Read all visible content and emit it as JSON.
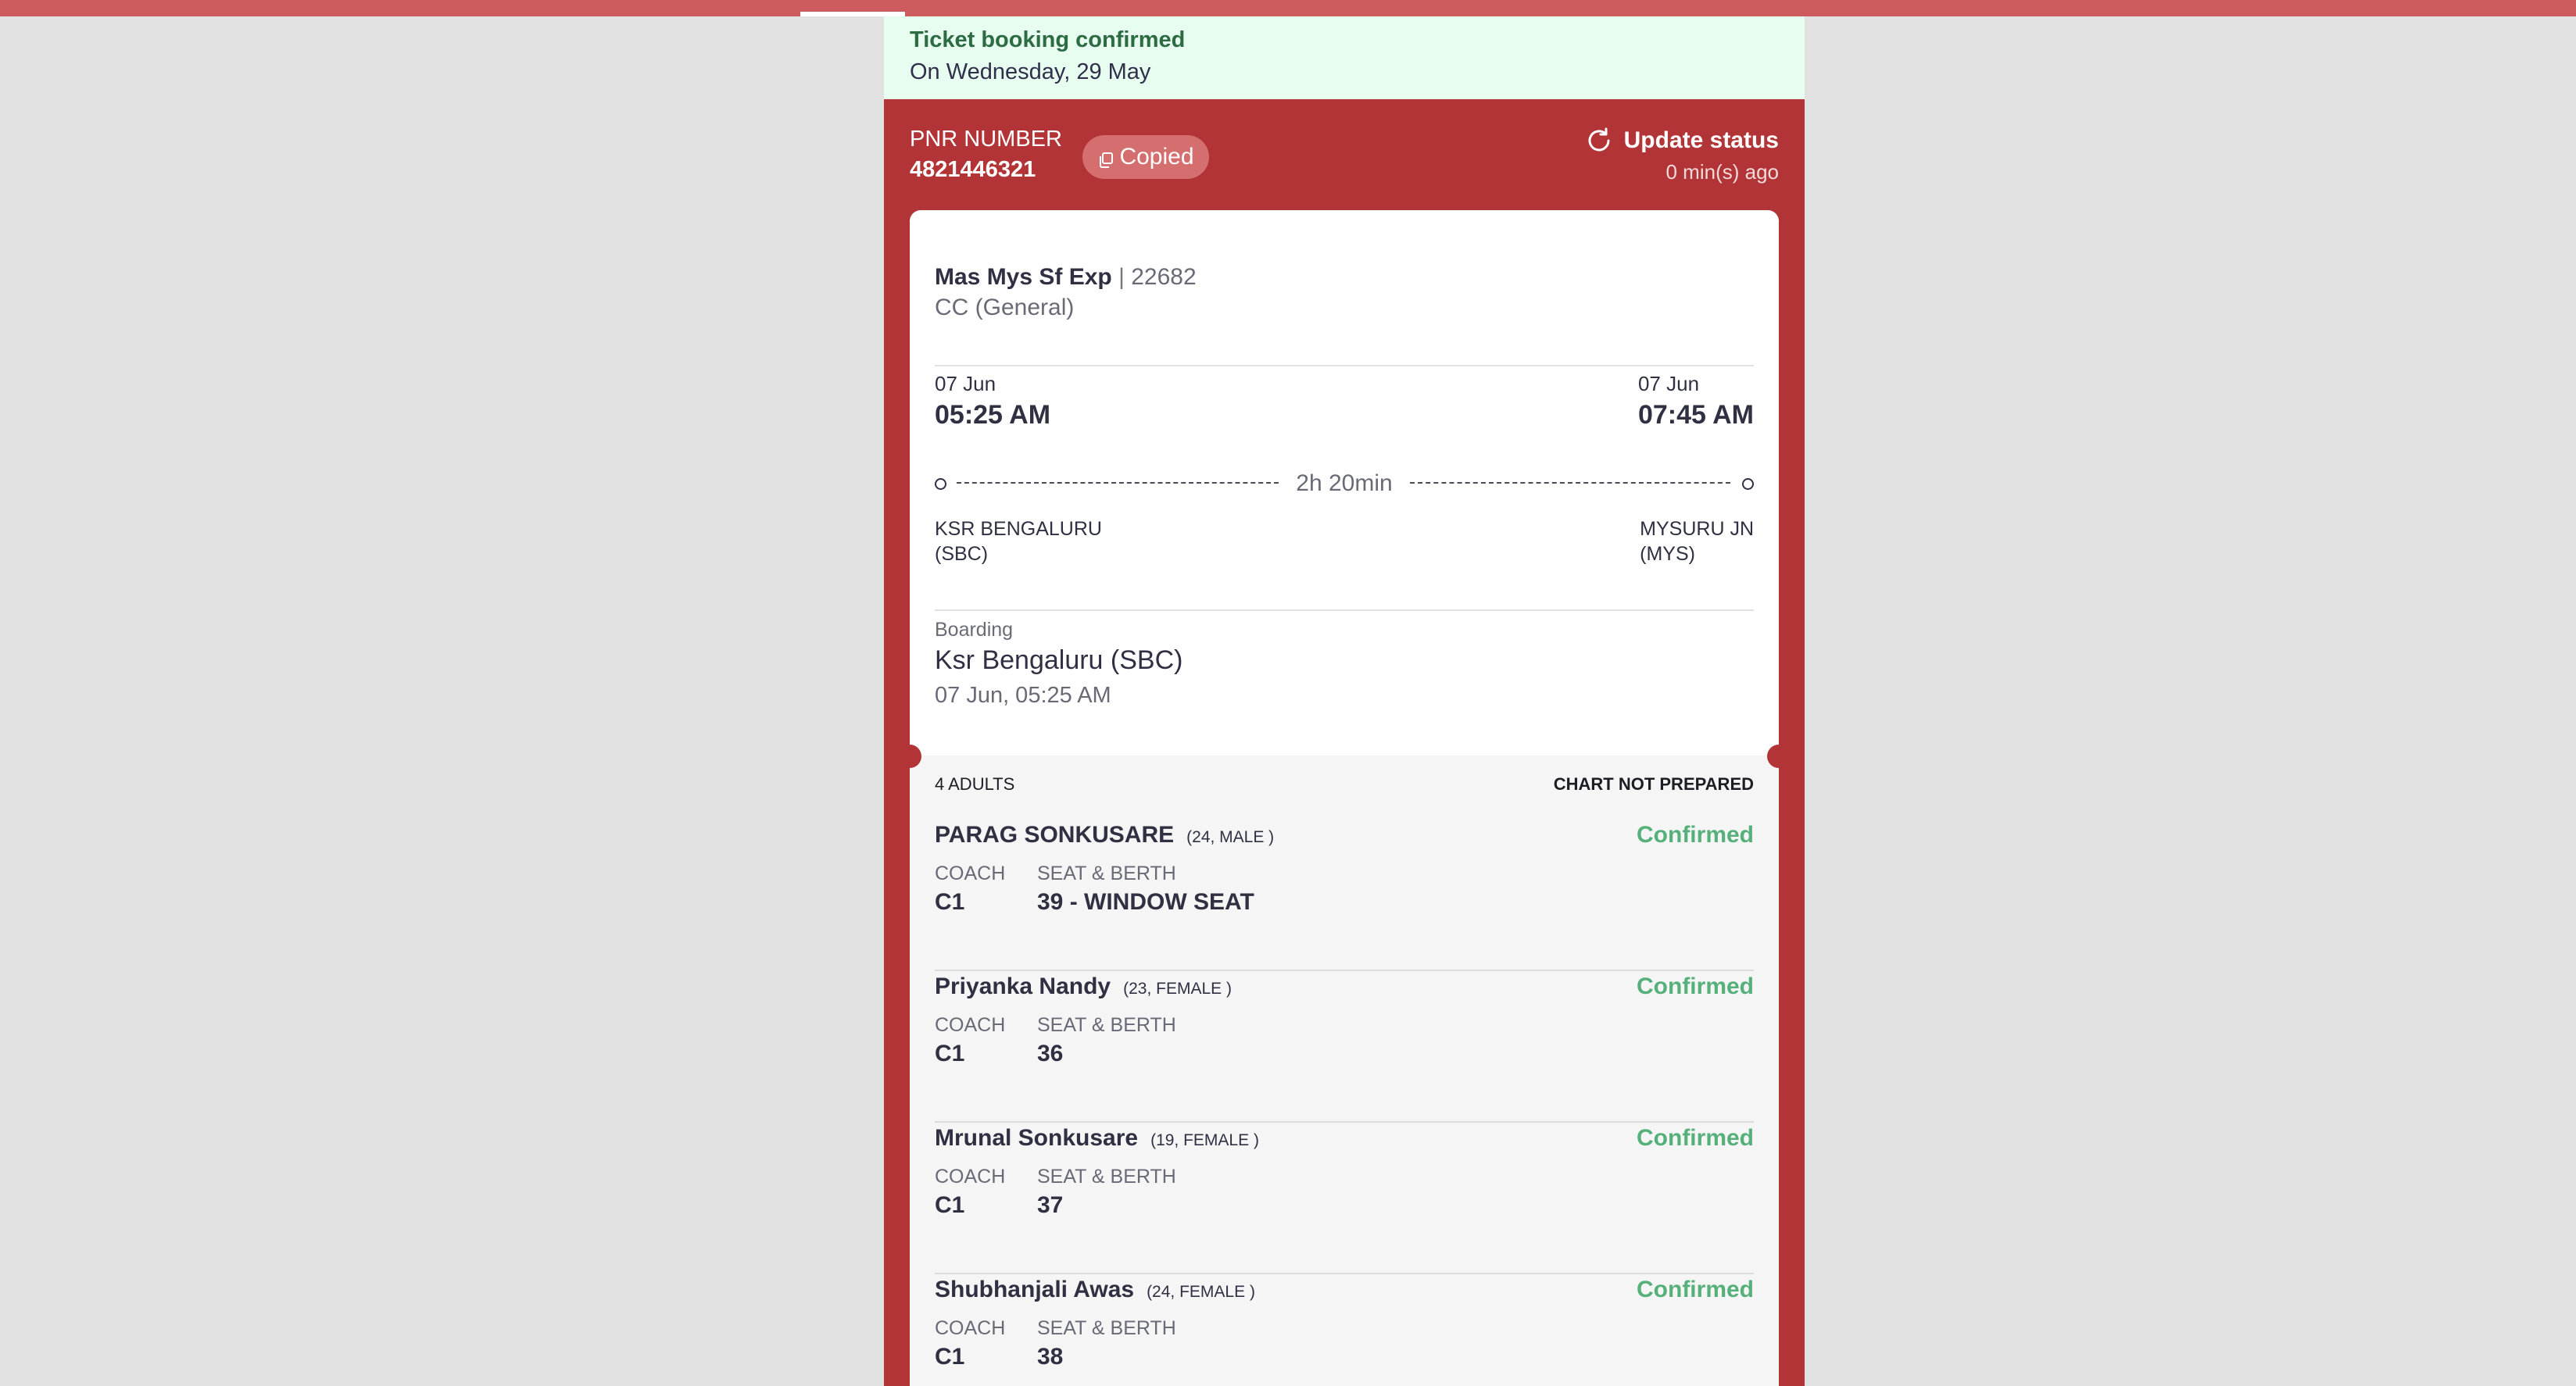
{
  "banner": {
    "title": "Ticket booking confirmed",
    "subtitle": "On Wednesday, 29 May"
  },
  "pnr": {
    "label": "PNR NUMBER",
    "number": "4821446321",
    "copy_chip": "Copied"
  },
  "update": {
    "label": "Update status",
    "time": "0 min(s) ago"
  },
  "train": {
    "name": "Mas Mys Sf Exp",
    "separator": "|",
    "number": "22682",
    "class": "CC (General)"
  },
  "departure": {
    "date": "07 Jun",
    "time": "05:25 AM",
    "station_name": "KSR BENGALURU",
    "station_code": "(SBC)"
  },
  "arrival": {
    "date": "07 Jun",
    "time": "07:45 AM",
    "station_name": "MYSURU JN",
    "station_code": "(MYS)"
  },
  "duration": "2h 20min",
  "boarding": {
    "label": "Boarding",
    "station": "Ksr Bengaluru (SBC)",
    "datetime": "07 Jun, 05:25 AM"
  },
  "passengers_header": {
    "count": "4 ADULTS",
    "chart_status": "CHART NOT PREPARED"
  },
  "field_labels": {
    "coach": "COACH",
    "seat": "SEAT & BERTH"
  },
  "passengers": [
    {
      "name": "PARAG SONKUSARE",
      "meta": "(24, MALE )",
      "status": "Confirmed",
      "coach": "C1",
      "seat": "39 - WINDOW SEAT"
    },
    {
      "name": "Priyanka Nandy",
      "meta": "(23, FEMALE )",
      "status": "Confirmed",
      "coach": "C1",
      "seat": "36"
    },
    {
      "name": "Mrunal Sonkusare",
      "meta": "(19, FEMALE )",
      "status": "Confirmed",
      "coach": "C1",
      "seat": "37"
    },
    {
      "name": "Shubhanjali Awas",
      "meta": "(24, FEMALE )",
      "status": "Confirmed",
      "coach": "C1",
      "seat": "38"
    }
  ],
  "colors": {
    "brand_red": "#b23437",
    "success_green": "#56b07a",
    "banner_bg": "#e6fdf0"
  }
}
